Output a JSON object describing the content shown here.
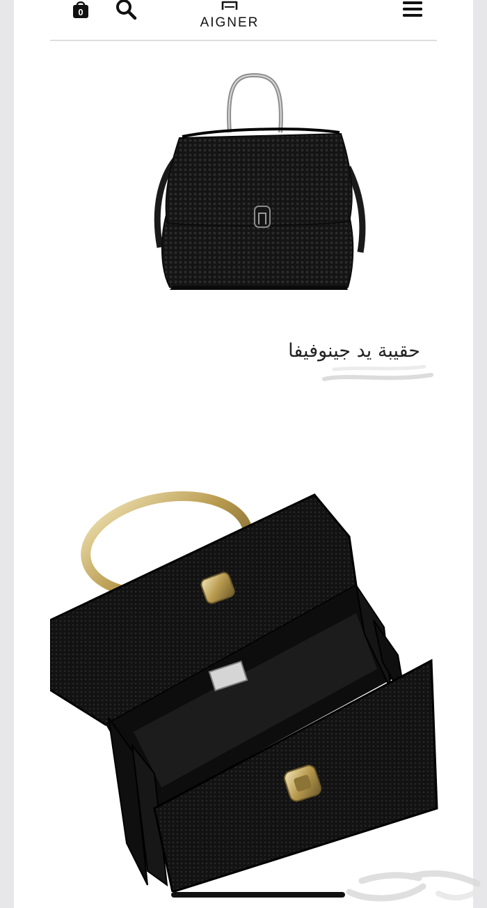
{
  "header": {
    "brand": "AIGNER",
    "cart_count": "0",
    "icons": [
      "shopping-bag-icon",
      "search-icon",
      "brand-horseshoe-logo",
      "hamburger-menu-icon"
    ]
  },
  "product": {
    "title": "حقيبة يد جينوفيفا",
    "images": [
      "black-leather-top-handle-bag-front",
      "black-leather-box-bag-open-interior"
    ]
  },
  "watermark": {
    "text": "حراج"
  },
  "colors": {
    "background": "#ffffff",
    "page_margin": "#e7e7e9",
    "brand_text": "#111111",
    "bag_black": "#111111",
    "hardware_gold": "#c8b06a"
  }
}
